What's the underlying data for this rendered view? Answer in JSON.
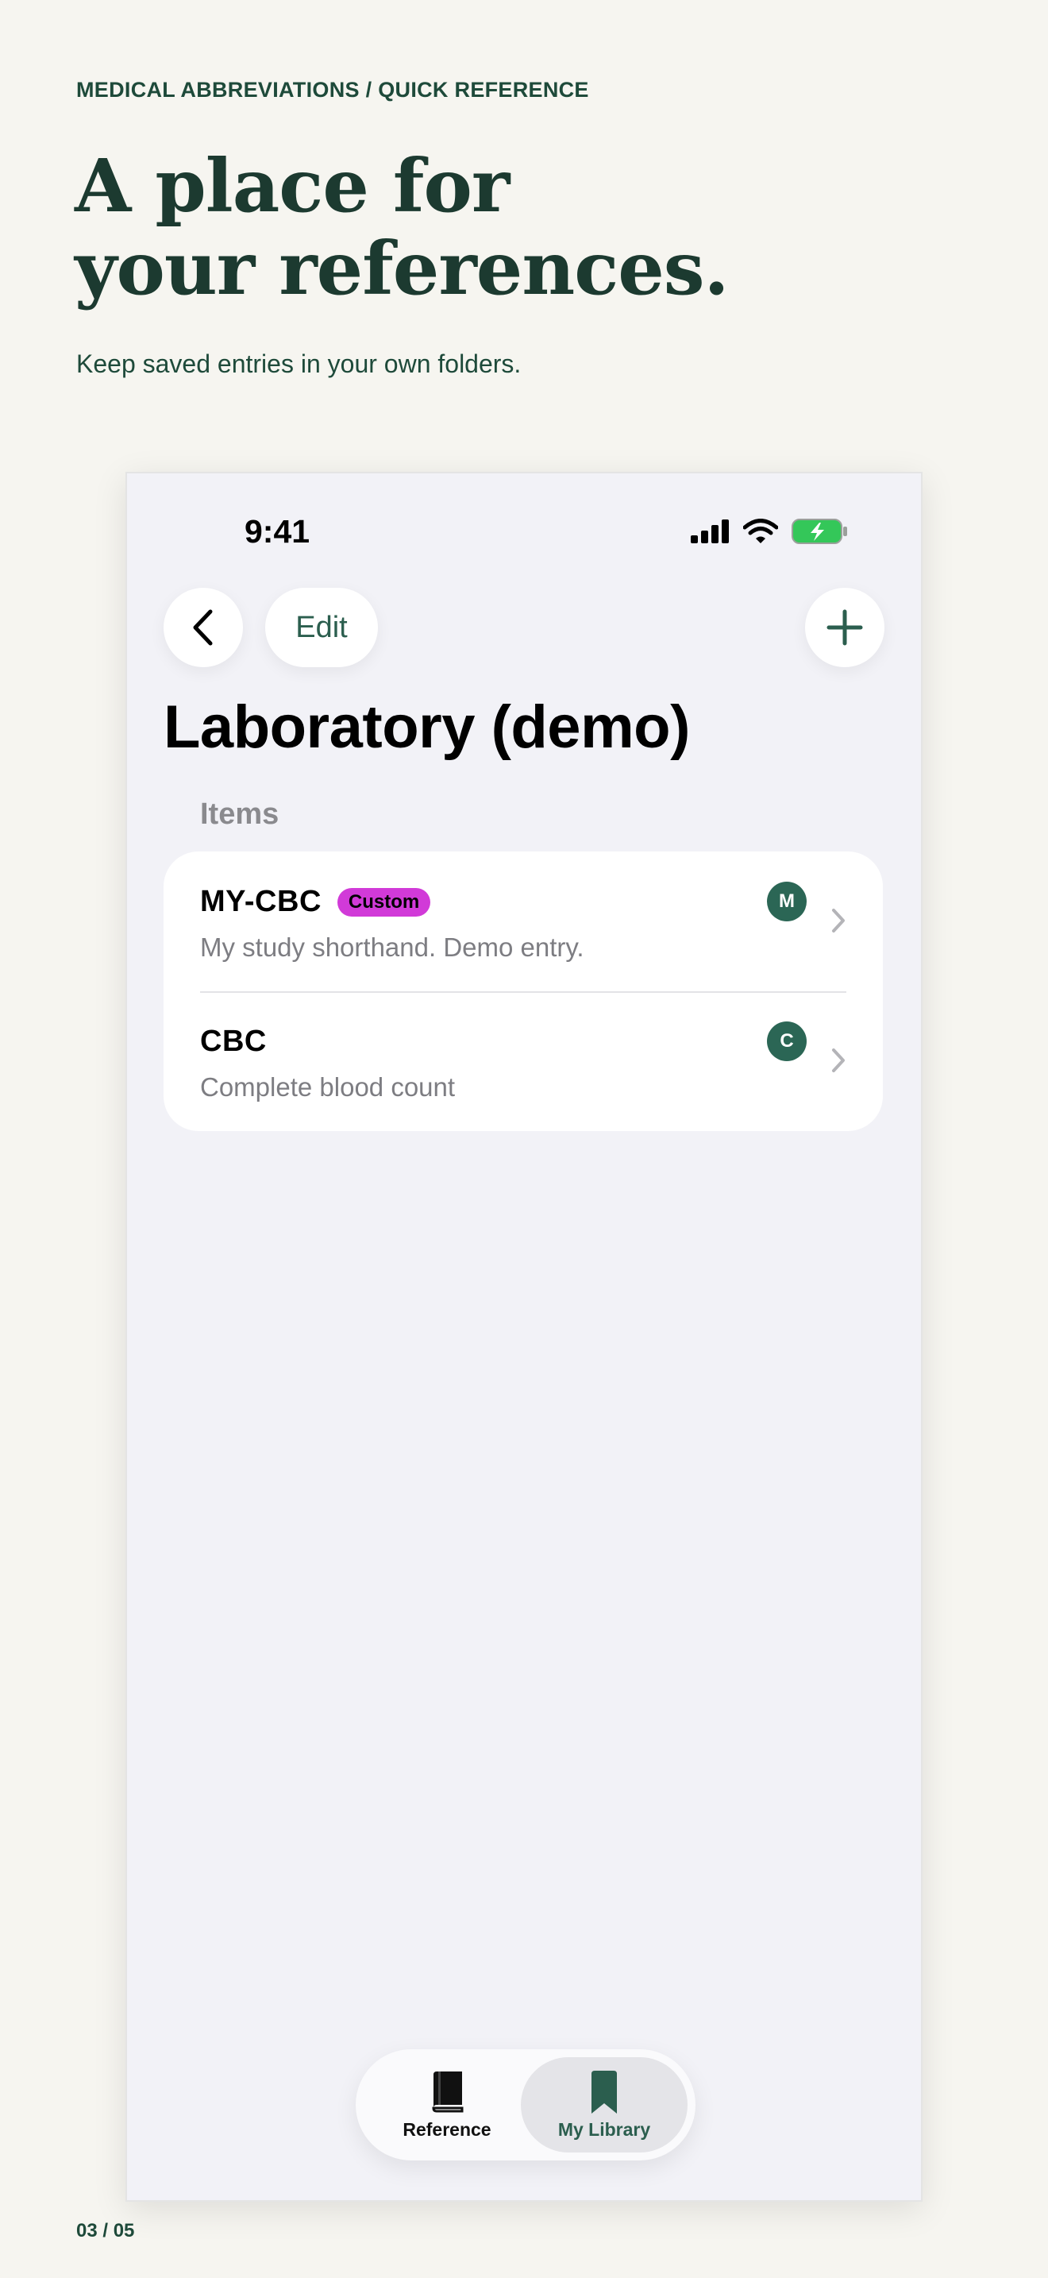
{
  "header": {
    "eyebrow": "MEDICAL ABBREVIATIONS / QUICK REFERENCE",
    "headline_line1": "A place for",
    "headline_line2": "your references.",
    "subhead": "Keep saved entries in your own folders."
  },
  "page_indicator": "03 / 05",
  "status_bar": {
    "time": "9:41",
    "icons": [
      "cellular-signal-icon",
      "wifi-icon",
      "battery-charging-icon"
    ]
  },
  "nav": {
    "back_icon": "chevron-left-icon",
    "edit_label": "Edit",
    "add_icon": "plus-icon"
  },
  "screen": {
    "title": "Laboratory (demo)",
    "section_label": "Items",
    "items": [
      {
        "name": "MY-CBC",
        "badge": "Custom",
        "subtitle": "My study shorthand. Demo entry.",
        "avatar": "M"
      },
      {
        "name": "CBC",
        "subtitle": "Complete blood count",
        "avatar": "C"
      }
    ]
  },
  "tab_bar": {
    "tabs": [
      {
        "label": "Reference",
        "icon": "book-icon",
        "selected": false
      },
      {
        "label": "My Library",
        "icon": "bookmark-icon",
        "selected": true
      }
    ]
  },
  "colors": {
    "page_background": "#f6f5f0",
    "brand_green": "#1e4a3a",
    "accent_teal": "#2b5e4e",
    "avatar_green": "#2b6655",
    "custom_badge": "#d13ad8",
    "battery_green": "#34c759"
  }
}
